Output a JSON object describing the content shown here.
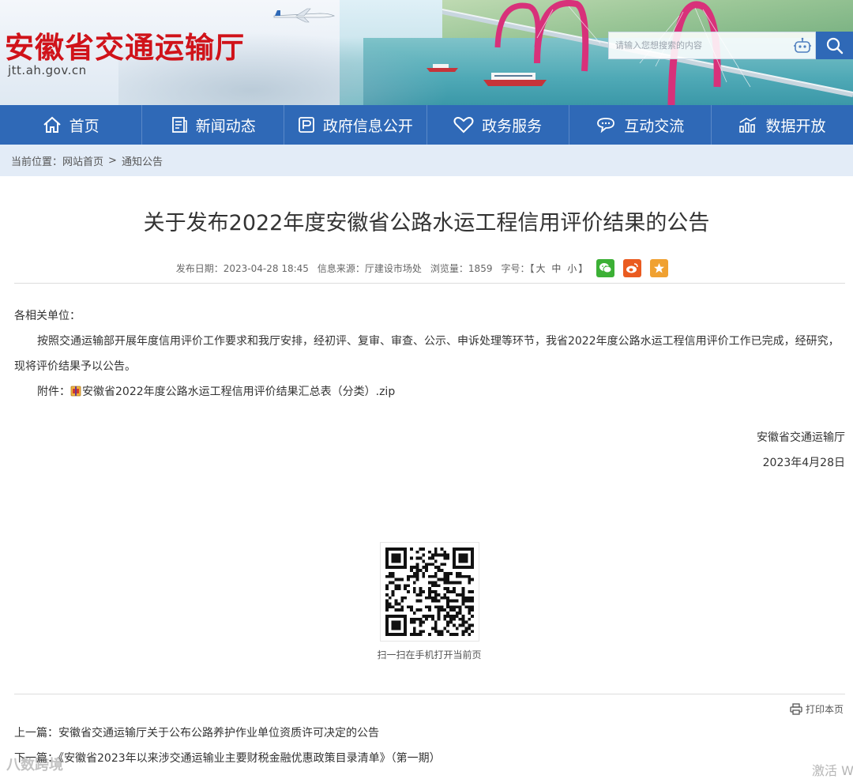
{
  "header": {
    "site_title": "安徽省交通运输厅",
    "site_domain": "jtt.ah.gov.cn",
    "search_placeholder": "请输入您想搜索的内容"
  },
  "nav": [
    {
      "label": "首页",
      "icon": "home-icon"
    },
    {
      "label": "新闻动态",
      "icon": "news-icon"
    },
    {
      "label": "政府信息公开",
      "icon": "info-icon"
    },
    {
      "label": "政务服务",
      "icon": "heart-icon"
    },
    {
      "label": "互动交流",
      "icon": "chat-icon"
    },
    {
      "label": "数据开放",
      "icon": "data-icon"
    }
  ],
  "breadcrumb": {
    "prefix": "当前位置：",
    "home": "网站首页",
    "sep": ">",
    "current": "通知公告"
  },
  "article": {
    "title": "关于发布2022年度安徽省公路水运工程信用评价结果的公告",
    "meta": {
      "date": "发布日期：2023-04-28 18:45",
      "source": "信息来源：厅建设市场处",
      "views": "浏览量：1859",
      "fontsize_label": "字号：",
      "fs_open": "【",
      "fs_large": "大",
      "fs_medium": "中",
      "fs_small": "小",
      "fs_close": "】"
    },
    "salutation": "各相关单位：",
    "paragraph": "按照交通运输部开展年度信用评价工作要求和我厅安排，经初评、复审、审查、公示、申诉处理等环节，我省2022年度公路水运工程信用评价工作已完成，经研究，现将评价结果予以公告。",
    "attachment_label": "附件：",
    "attachment_name": "安徽省2022年度公路水运工程信用评价结果汇总表（分类）.zip",
    "signature_org": "安徽省交通运输厅",
    "signature_date": "2023年4月28日"
  },
  "qr_caption": "扫一扫在手机打开当前页",
  "print_label": "打印本页",
  "prev": {
    "label": "上一篇：",
    "title": "安徽省交通运输厅关于公布公路养护作业单位资质许可决定的公告"
  },
  "next": {
    "label": "下一篇：",
    "title": "《安徽省2023年以来涉交通运输业主要财税金融优惠政策目录清单》（第一期）"
  },
  "watermarks": {
    "left": "八数跨境",
    "right": "激活 W"
  },
  "colors": {
    "nav_bg": "#2f69b7",
    "title_red": "#d0131a",
    "breadcrumb_bg": "#e3ecf7",
    "wechat": "#3cb035",
    "weibo": "#ea5b20",
    "favorite": "#f0a131"
  }
}
